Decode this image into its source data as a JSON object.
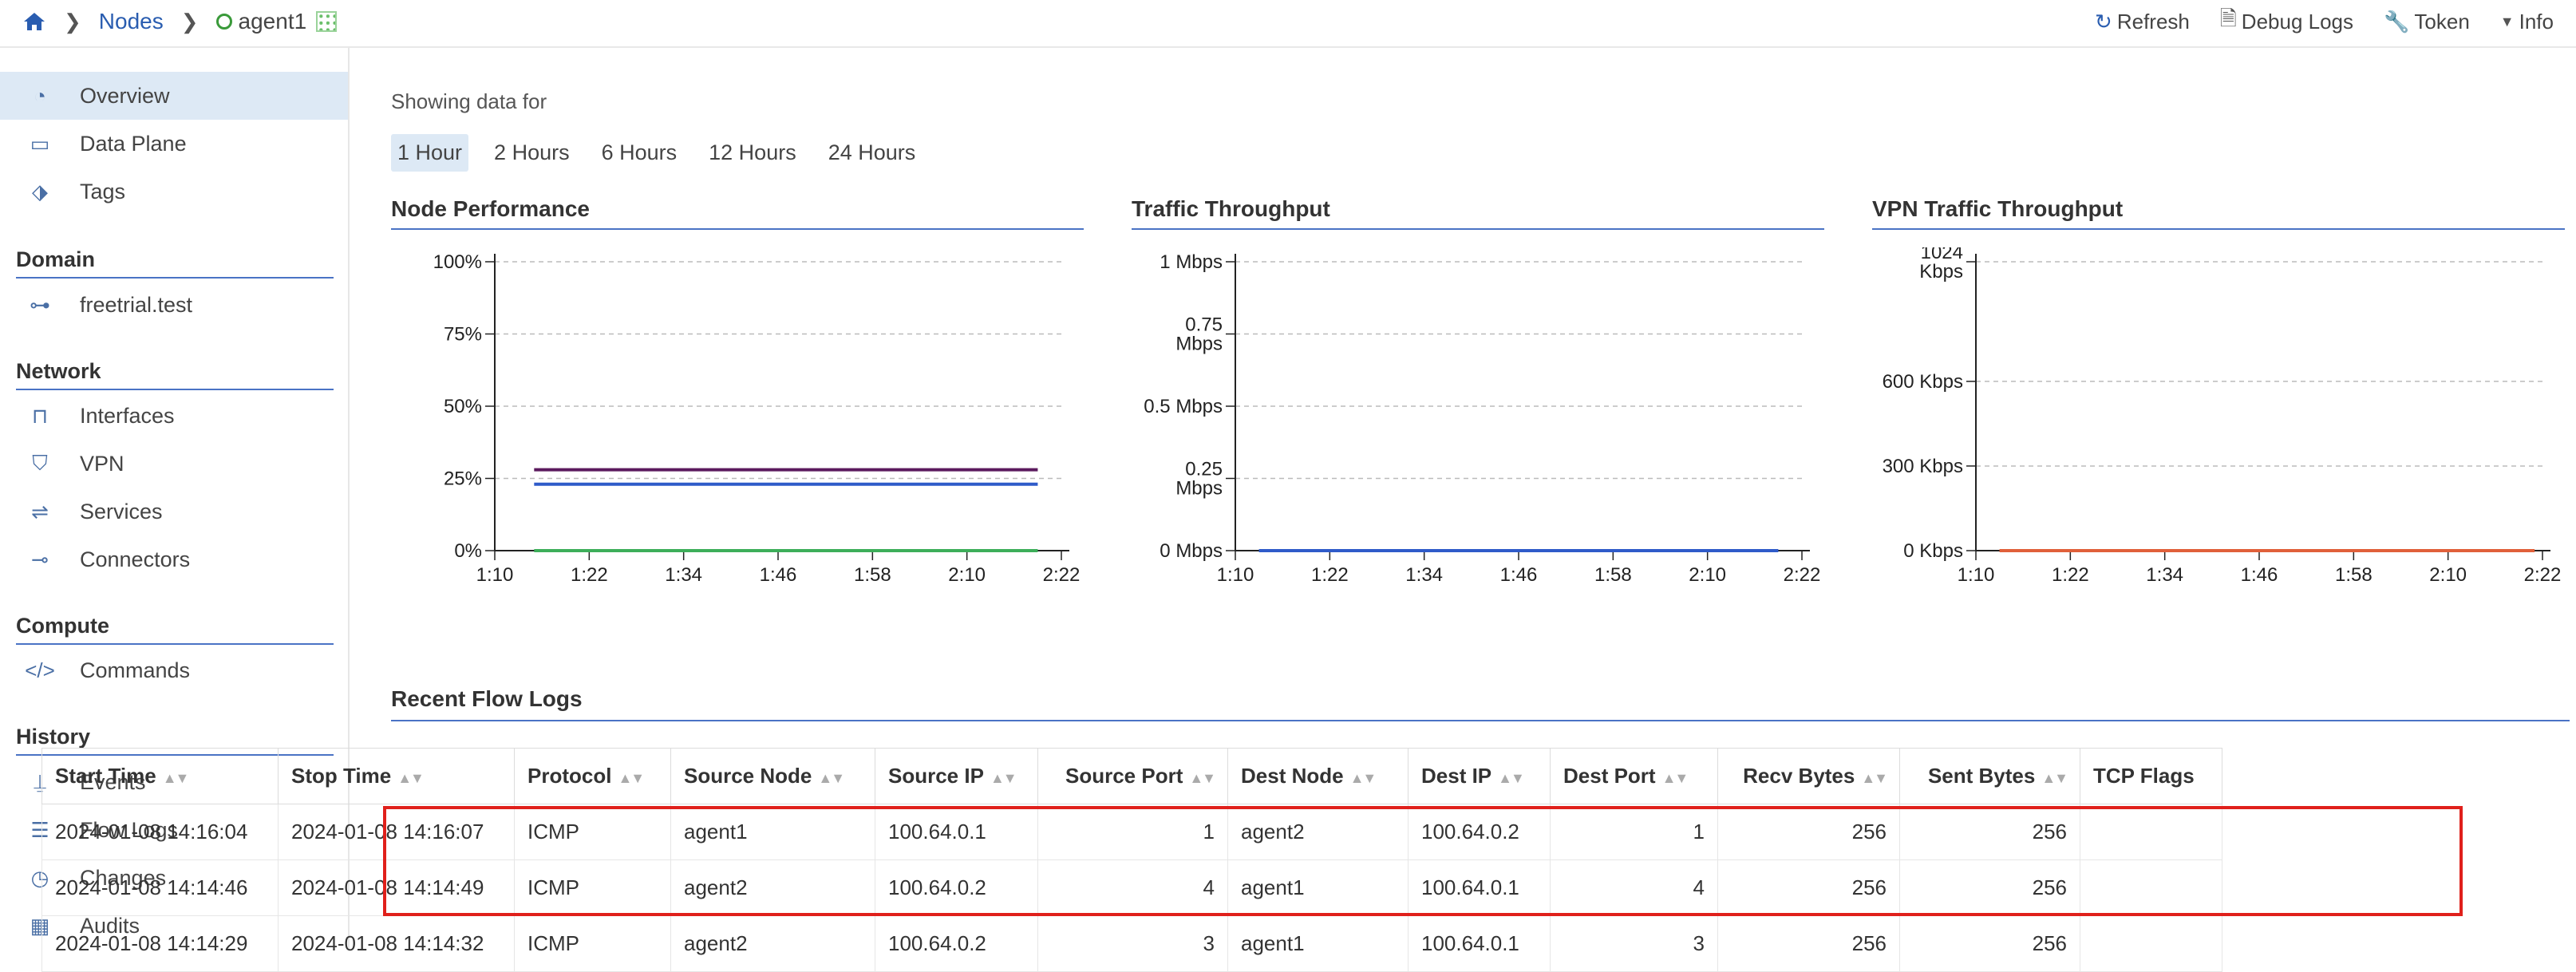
{
  "breadcrumb": {
    "nodes_label": "Nodes",
    "node_name": "agent1"
  },
  "actions": {
    "refresh": "Refresh",
    "debug_logs": "Debug Logs",
    "token": "Token",
    "info": "Info"
  },
  "sidebar": {
    "top_items": [
      {
        "label": "Overview",
        "icon": "dashboard-icon",
        "active": true
      },
      {
        "label": "Data Plane",
        "icon": "data-plane-icon"
      },
      {
        "label": "Tags",
        "icon": "tag-icon"
      }
    ],
    "sections": [
      {
        "title": "Domain",
        "items": [
          {
            "label": "freetrial.test",
            "icon": "sitemap-icon"
          }
        ]
      },
      {
        "title": "Network",
        "items": [
          {
            "label": "Interfaces",
            "icon": "network-icon"
          },
          {
            "label": "VPN",
            "icon": "vpn-icon"
          },
          {
            "label": "Services",
            "icon": "services-icon"
          },
          {
            "label": "Connectors",
            "icon": "connector-icon"
          }
        ]
      },
      {
        "title": "Compute",
        "items": [
          {
            "label": "Commands",
            "icon": "code-icon"
          }
        ]
      },
      {
        "title": "History",
        "items": [
          {
            "label": "Events",
            "icon": "tower-icon"
          },
          {
            "label": "Flow Logs",
            "icon": "list-icon"
          },
          {
            "label": "Changes",
            "icon": "clock-icon"
          },
          {
            "label": "Audits",
            "icon": "audit-icon"
          }
        ]
      }
    ]
  },
  "main": {
    "showing_label": "Showing data for",
    "ranges": [
      "1 Hour",
      "2 Hours",
      "6 Hours",
      "12 Hours",
      "24 Hours"
    ],
    "active_range": "1 Hour",
    "flow_title": "Recent Flow Logs"
  },
  "chart_data": [
    {
      "type": "line",
      "title": "Node Performance",
      "x_ticks": [
        "1:10",
        "1:22",
        "1:34",
        "1:46",
        "1:58",
        "2:10",
        "2:22"
      ],
      "y_ticks": [
        "0%",
        "25%",
        "50%",
        "75%",
        "100%"
      ],
      "ylim": [
        0,
        100
      ],
      "grid": true,
      "series": [
        {
          "color": "#5b1a5e",
          "values": [
            28,
            28
          ]
        },
        {
          "color": "#2f5bc9",
          "values": [
            23,
            23
          ]
        },
        {
          "color": "#3dae5a",
          "values": [
            0,
            0
          ]
        }
      ],
      "x_range": [
        "1:15",
        "2:19"
      ]
    },
    {
      "type": "line",
      "title": "Traffic Throughput",
      "x_ticks": [
        "1:10",
        "1:22",
        "1:34",
        "1:46",
        "1:58",
        "2:10",
        "2:22"
      ],
      "y_ticks": [
        "0 Mbps",
        "0.25 Mbps",
        "0.5 Mbps",
        "0.75 Mbps",
        "1 Mbps"
      ],
      "ylim": [
        0,
        1
      ],
      "grid": true,
      "series": [
        {
          "color": "#2f5bc9",
          "values": [
            0,
            0
          ]
        }
      ],
      "x_range": [
        "1:13",
        "2:19"
      ]
    },
    {
      "type": "line",
      "title": "VPN Traffic Throughput",
      "x_ticks": [
        "1:10",
        "1:22",
        "1:34",
        "1:46",
        "1:58",
        "2:10",
        "2:22"
      ],
      "y_ticks": [
        "0 Kbps",
        "300 Kbps",
        "600 Kbps",
        "1024 Kbps"
      ],
      "ylim": [
        0,
        1024
      ],
      "grid": true,
      "series": [
        {
          "color": "#e0603a",
          "values": [
            0,
            0
          ]
        }
      ],
      "x_range": [
        "1:13",
        "2:21"
      ]
    }
  ],
  "table": {
    "columns": [
      "Start Time",
      "Stop Time",
      "Protocol",
      "Source Node",
      "Source IP",
      "Source Port",
      "Dest Node",
      "Dest IP",
      "Dest Port",
      "Recv Bytes",
      "Sent Bytes",
      "TCP Flags"
    ],
    "rows": [
      [
        "2024-01-08 14:16:04",
        "2024-01-08 14:16:07",
        "ICMP",
        "agent1",
        "100.64.0.1",
        "1",
        "agent2",
        "100.64.0.2",
        "1",
        "256",
        "256",
        ""
      ],
      [
        "2024-01-08 14:14:46",
        "2024-01-08 14:14:49",
        "ICMP",
        "agent2",
        "100.64.0.2",
        "4",
        "agent1",
        "100.64.0.1",
        "4",
        "256",
        "256",
        ""
      ],
      [
        "2024-01-08 14:14:29",
        "2024-01-08 14:14:32",
        "ICMP",
        "agent2",
        "100.64.0.2",
        "3",
        "agent1",
        "100.64.0.1",
        "3",
        "256",
        "256",
        ""
      ]
    ]
  }
}
